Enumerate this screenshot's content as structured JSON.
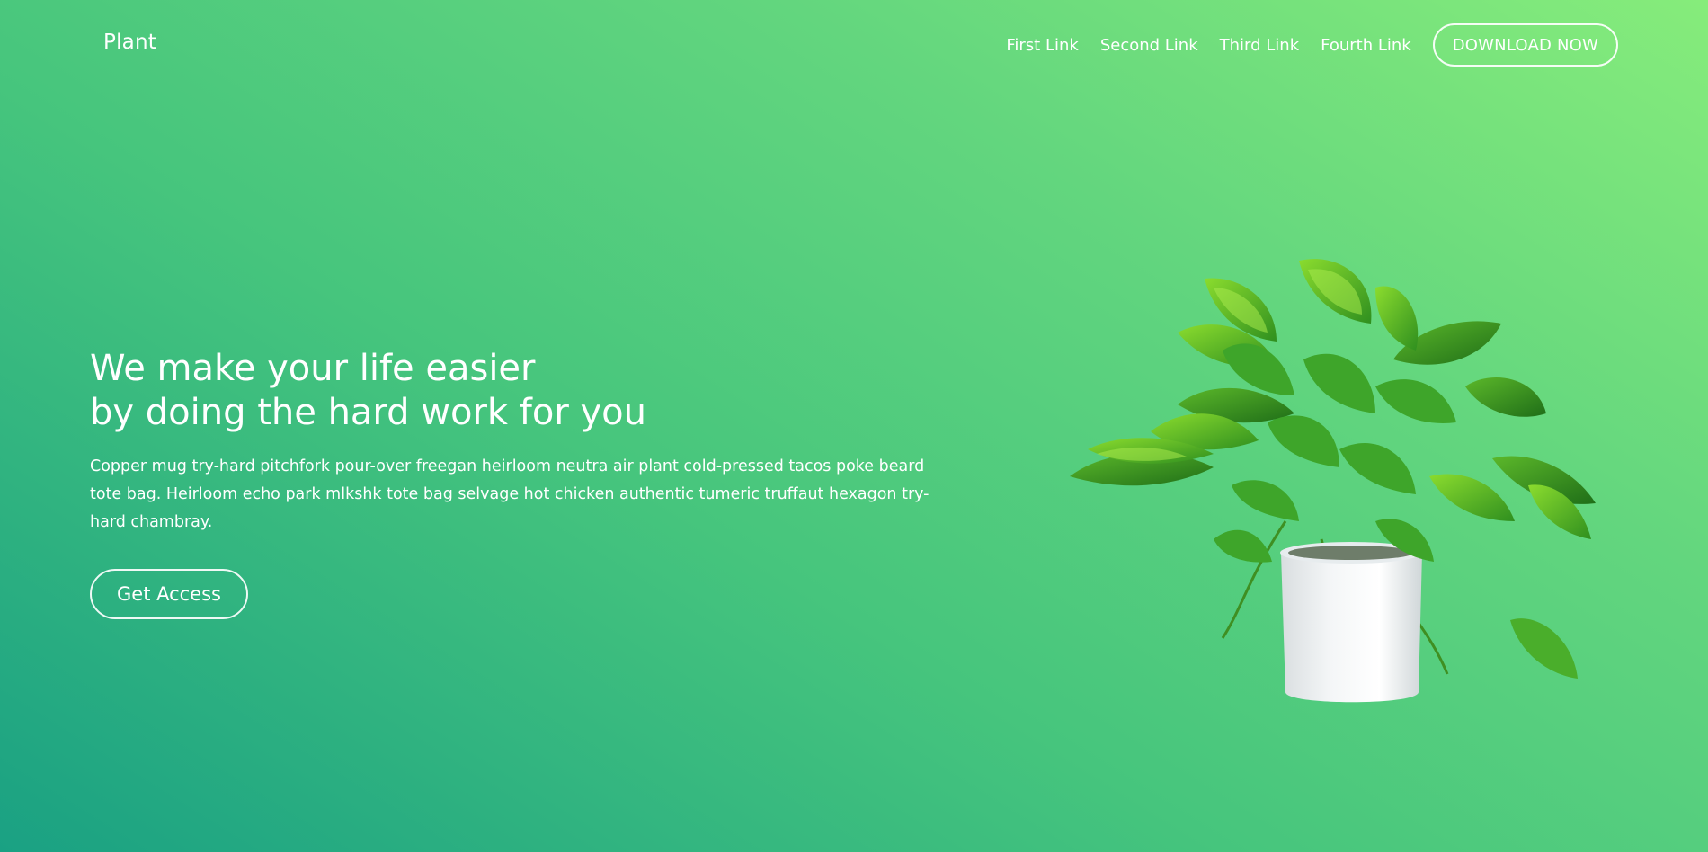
{
  "header": {
    "logo": "Plant",
    "nav_links": [
      "First Link",
      "Second Link",
      "Third Link",
      "Fourth Link"
    ],
    "download_label": "DOWNLOAD NOW"
  },
  "hero": {
    "title_line_1": "We make your life easier",
    "title_line_2": "by doing the hard work for you",
    "body": "Copper mug try-hard pitchfork pour-over freegan heirloom neutra air plant cold-pressed tacos poke beard tote bag. Heirloom echo park mlkshk tote bag selvage hot chicken authentic tumeric truffaut hexagon try-hard chambray.",
    "cta_label": "Get Access"
  },
  "image": {
    "subject": "potted pothos plant in white pot"
  },
  "colors": {
    "gradient_top_right": "#86ec7b",
    "gradient_bottom_left": "#1aa183",
    "text": "#ffffff"
  }
}
